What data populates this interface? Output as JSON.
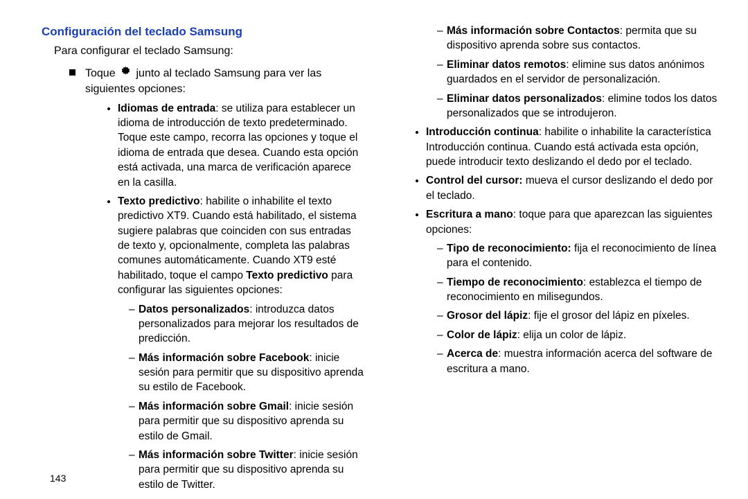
{
  "header": {
    "title": "Configuración del teclado Samsung"
  },
  "intro": "Para configurar el teclado Samsung:",
  "step": {
    "pre": "Toque ",
    "post": " junto al teclado Samsung para ver las siguientes opciones:"
  },
  "left_bullets": [
    {
      "bold": "Idiomas de entrada",
      "text": ": se utiliza para establecer un idioma de introducción de texto predeterminado. Toque este campo, recorra las opciones y toque el idioma de entrada que desea. Cuando esta opción está activada, una marca de verificación aparece en la casilla."
    },
    {
      "bold": "Texto predictivo",
      "text_pre": ": habilite o inhabilite el texto predictivo XT9. Cuando está habilitado, el sistema sugiere palabras que coinciden con sus entradas de texto y, opcionalmente, completa las palabras comunes automáticamente. Cuando XT9 esté habilitado, toque el campo ",
      "text_bold_mid": "Texto predictivo",
      "text_post": " para configurar las siguientes opciones:",
      "subs": [
        {
          "bold": "Datos personalizados",
          "text": ": introduzca datos personalizados para mejorar los resultados de predicción."
        },
        {
          "bold": "Más información sobre Facebook",
          "text": ": inicie sesión para permitir que su dispositivo aprenda su estilo de Facebook."
        },
        {
          "bold": "Más información sobre Gmail",
          "text": ": inicie sesión para permitir que su dispositivo aprenda su estilo de Gmail."
        },
        {
          "bold": "Más información sobre Twitter",
          "text": ": inicie sesión para permitir que su dispositivo aprenda su estilo de Twitter."
        }
      ]
    }
  ],
  "right_top_subs": [
    {
      "bold": "Más información sobre Contactos",
      "text": ": permita que su dispositivo aprenda sobre sus contactos."
    },
    {
      "bold": "Eliminar datos remotos",
      "text": ": elimine sus datos anónimos guardados en el servidor de personalización."
    },
    {
      "bold": "Eliminar datos personalizados",
      "text": ": elimine todos los datos personalizados que se introdujeron."
    }
  ],
  "right_bullets": [
    {
      "bold": "Introducción continua",
      "text": ": habilite o inhabilite la característica Introducción continua. Cuando está activada esta opción, puede introducir texto deslizando el dedo por el teclado."
    },
    {
      "bold": "Control del cursor:",
      "text": " mueva el cursor deslizando el dedo por el teclado."
    },
    {
      "bold": "Escritura a mano",
      "text": ": toque para que aparezcan las siguientes opciones:",
      "subs": [
        {
          "bold": "Tipo de reconocimiento:",
          "text": " fija el reconocimiento de línea para el contenido."
        },
        {
          "bold": "Tiempo de reconocimiento",
          "text": ": establezca el tiempo de reconocimiento en milisegundos."
        },
        {
          "bold": "Grosor del lápiz",
          "text": ": fije el grosor del lápiz en píxeles."
        },
        {
          "bold": "Color de lápiz",
          "text": ": elija un color de lápiz."
        },
        {
          "bold": "Acerca de",
          "text": ": muestra información acerca del software de escritura a mano."
        }
      ]
    }
  ],
  "page_number": "143"
}
